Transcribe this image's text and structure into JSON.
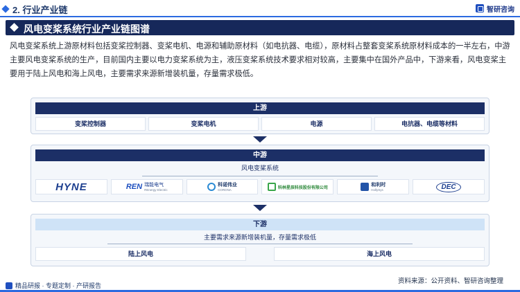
{
  "header": {
    "section_title": "2. 行业产业链",
    "brand_name": "智研咨询"
  },
  "banner": {
    "title": "风电变桨系统行业产业链图谱"
  },
  "description": "风电变桨系统上游原材料包括变桨控制器、变桨电机、电源和辅助原材料（如电抗器、电缆），原材料占整套变桨系统原材料成本的一半左右，中游主要风电变桨系统的生产，目前国内主要以电力变桨系统为主，液压变桨系统技术要求相对较高，主要集中在国外产品中，下游来看，风电变桨主要用于陆上风电和海上风电，主要需求来源新增装机量，存量需求极低。",
  "upstream": {
    "title": "上游",
    "items": [
      "变桨控制器",
      "变桨电机",
      "电源",
      "电抗器、电缆等材料"
    ]
  },
  "midstream": {
    "title": "中游",
    "subtitle": "风电变桨系统",
    "logos": [
      {
        "name": "HYNE",
        "icon": "hyne-logo"
      },
      {
        "name": "REN",
        "cn": "瑞能电气",
        "en": "REnergy Electric",
        "icon": "ren-logo"
      },
      {
        "name": "科诺伟业",
        "en": "CORONA",
        "icon": "corona-logo"
      },
      {
        "name": "科林星辰科技股份有限公司",
        "icon": "kelin-logo"
      },
      {
        "name": "和利时",
        "en": "HollySys",
        "icon": "hollysys-logo"
      },
      {
        "name": "DEC",
        "icon": "dec-logo"
      }
    ]
  },
  "downstream": {
    "title": "下游",
    "subtitle": "主要需求来源新增装机量，存量需求极低",
    "items": [
      "陆上风电",
      "海上风电"
    ]
  },
  "footer": {
    "left": "精品研报 · 专题定制 · 产研报告",
    "source": "资料来源：公开资料、智研咨询整理"
  },
  "colors": {
    "accent": "#2b6ae0",
    "navy": "#1c2f66",
    "banner": "#16285a"
  }
}
